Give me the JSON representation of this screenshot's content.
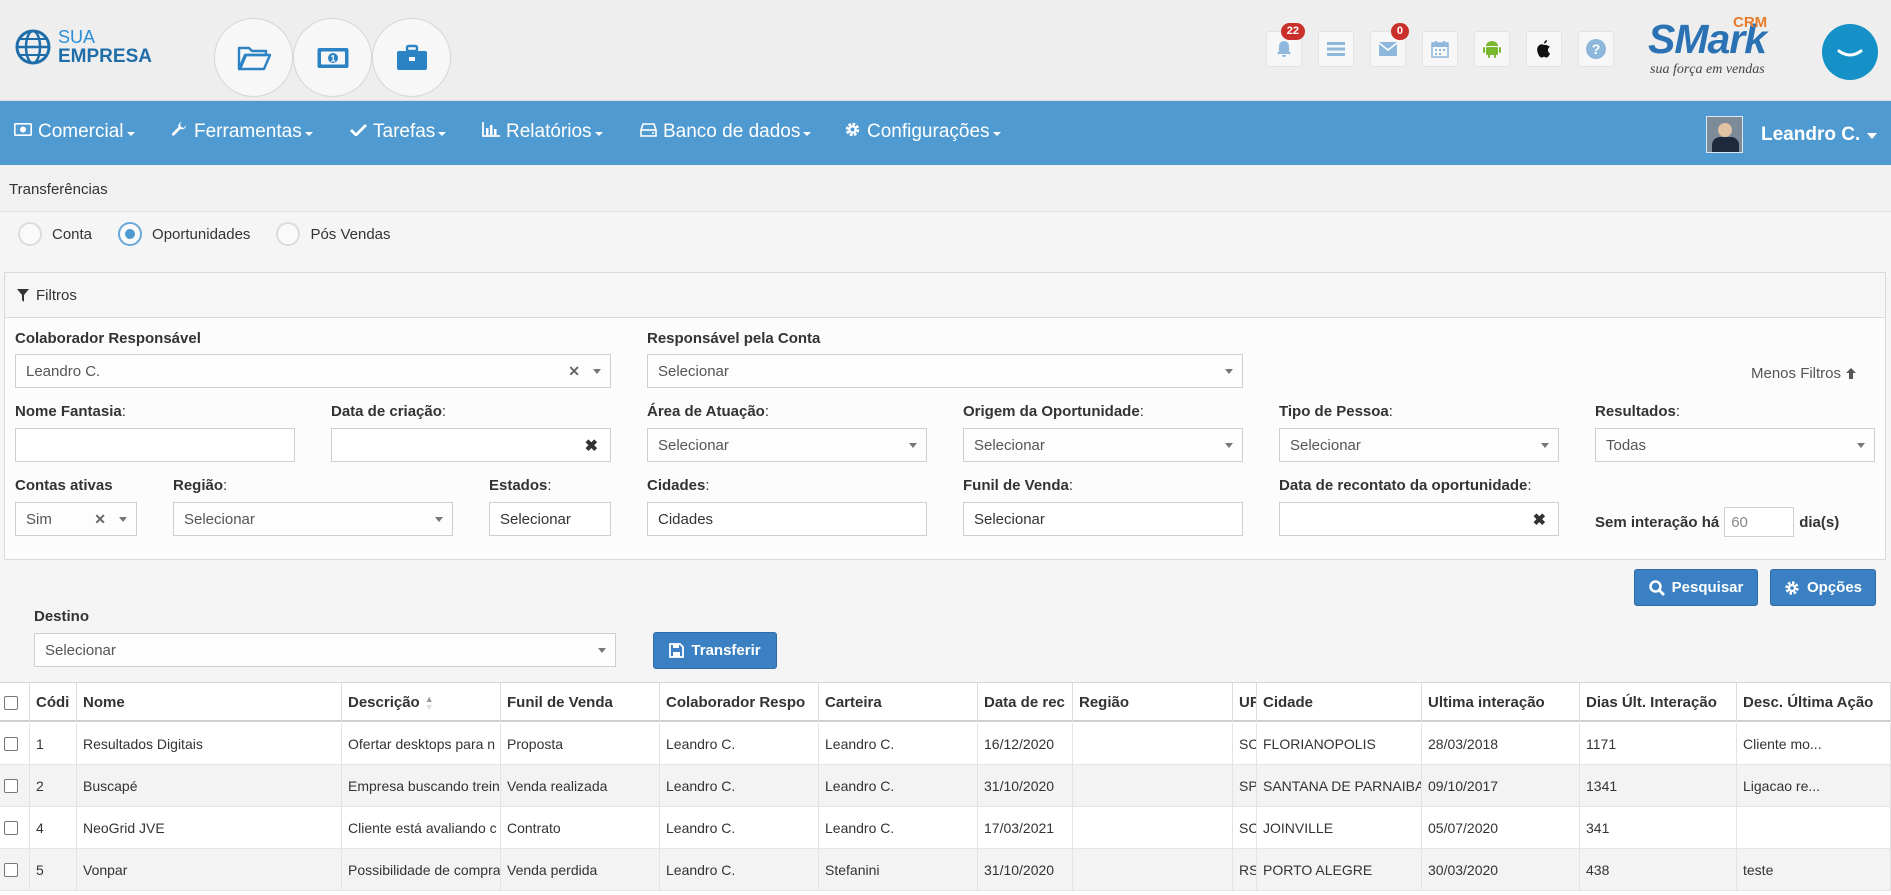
{
  "brand": {
    "line1": "SUA",
    "line2": "EMPRESA"
  },
  "quick_buttons": [
    "folder-open-icon",
    "money-icon",
    "briefcase-icon"
  ],
  "notifications": {
    "bell_count": "22",
    "mail_count": "0"
  },
  "smark": {
    "name": "SMark",
    "crm": "CRM",
    "tagline": "sua força em vendas"
  },
  "nav": {
    "items": [
      {
        "label": "Comercial",
        "icon": "money-icon"
      },
      {
        "label": "Ferramentas",
        "icon": "wrench-icon"
      },
      {
        "label": "Tarefas",
        "icon": "check-icon"
      },
      {
        "label": "Relatórios",
        "icon": "bar-chart-icon"
      },
      {
        "label": "Banco de dados",
        "icon": "hdd-icon"
      },
      {
        "label": "Configurações",
        "icon": "gear-icon"
      }
    ],
    "user": "Leandro C."
  },
  "page_title": "Transferências",
  "radios": [
    {
      "label": "Conta",
      "selected": false
    },
    {
      "label": "Oportunidades",
      "selected": true
    },
    {
      "label": "Pós Vendas",
      "selected": false
    }
  ],
  "filters": {
    "title": "Filtros",
    "menos_filtros": "Menos Filtros",
    "colaborador_label": "Colaborador Responsável",
    "colaborador_value": "Leandro C.",
    "responsavel_conta_label": "Responsável pela Conta",
    "responsavel_conta_value": "Selecionar",
    "nome_fantasia_label": "Nome Fantasia",
    "data_criacao_label": "Data de criação",
    "area_label": "Área de Atuação",
    "area_value": "Selecionar",
    "origem_label": "Origem da Oportunidade",
    "origem_value": "Selecionar",
    "tipo_pessoa_label": "Tipo de Pessoa",
    "tipo_pessoa_value": "Selecionar",
    "resultados_label": "Resultados",
    "resultados_value": "Todas",
    "contas_ativas_label": "Contas ativas",
    "contas_ativas_value": "Sim",
    "regiao_label": "Região",
    "regiao_value": "Selecionar",
    "estados_label": "Estados",
    "estados_value": "Selecionar",
    "cidades_label": "Cidades",
    "cidades_value": "Cidades",
    "funil_label": "Funil de Venda",
    "funil_value": "Selecionar",
    "recontato_label": "Data de recontato da oportunidade",
    "sem_interacao_label": "Sem interação há",
    "sem_interacao_value": "60",
    "dias_label": "dia(s)"
  },
  "actions": {
    "pesquisar": "Pesquisar",
    "opcoes": "Opções",
    "destino_label": "Destino",
    "destino_value": "Selecionar",
    "transferir": "Transferir"
  },
  "table": {
    "columns": [
      "Códi",
      "Nome",
      "Descrição",
      "Funil de Venda",
      "Colaborador Respo",
      "Carteira",
      "Data de rec",
      "Região",
      "UF",
      "Cidade",
      "Ultima interação",
      "Dias Últ. Interação",
      "Desc. Última Ação"
    ],
    "rows": [
      [
        "1",
        "Resultados Digitais",
        "Ofertar desktops para n",
        "Proposta",
        "Leandro C.",
        "Leandro C.",
        "16/12/2020",
        "",
        "SC",
        "FLORIANOPOLIS",
        "28/03/2018",
        "1171",
        "Cliente mo..."
      ],
      [
        "2",
        "Buscapé",
        "Empresa buscando trein",
        "Venda realizada",
        "Leandro C.",
        "Leandro C.",
        "31/10/2020",
        "",
        "SP",
        "SANTANA DE PARNAIBA",
        "09/10/2017",
        "1341",
        "Ligacao re..."
      ],
      [
        "4",
        "NeoGrid JVE",
        "Cliente está avaliando c",
        "Contrato",
        "Leandro C.",
        "Leandro C.",
        "17/03/2021",
        "",
        "SC",
        "JOINVILLE",
        "05/07/2020",
        "341",
        ""
      ],
      [
        "5",
        "Vonpar",
        "Possibilidade de compra",
        "Venda perdida",
        "Leandro C.",
        "Stefanini",
        "31/10/2020",
        "",
        "RS",
        "PORTO ALEGRE",
        "30/03/2020",
        "438",
        "teste"
      ]
    ]
  }
}
